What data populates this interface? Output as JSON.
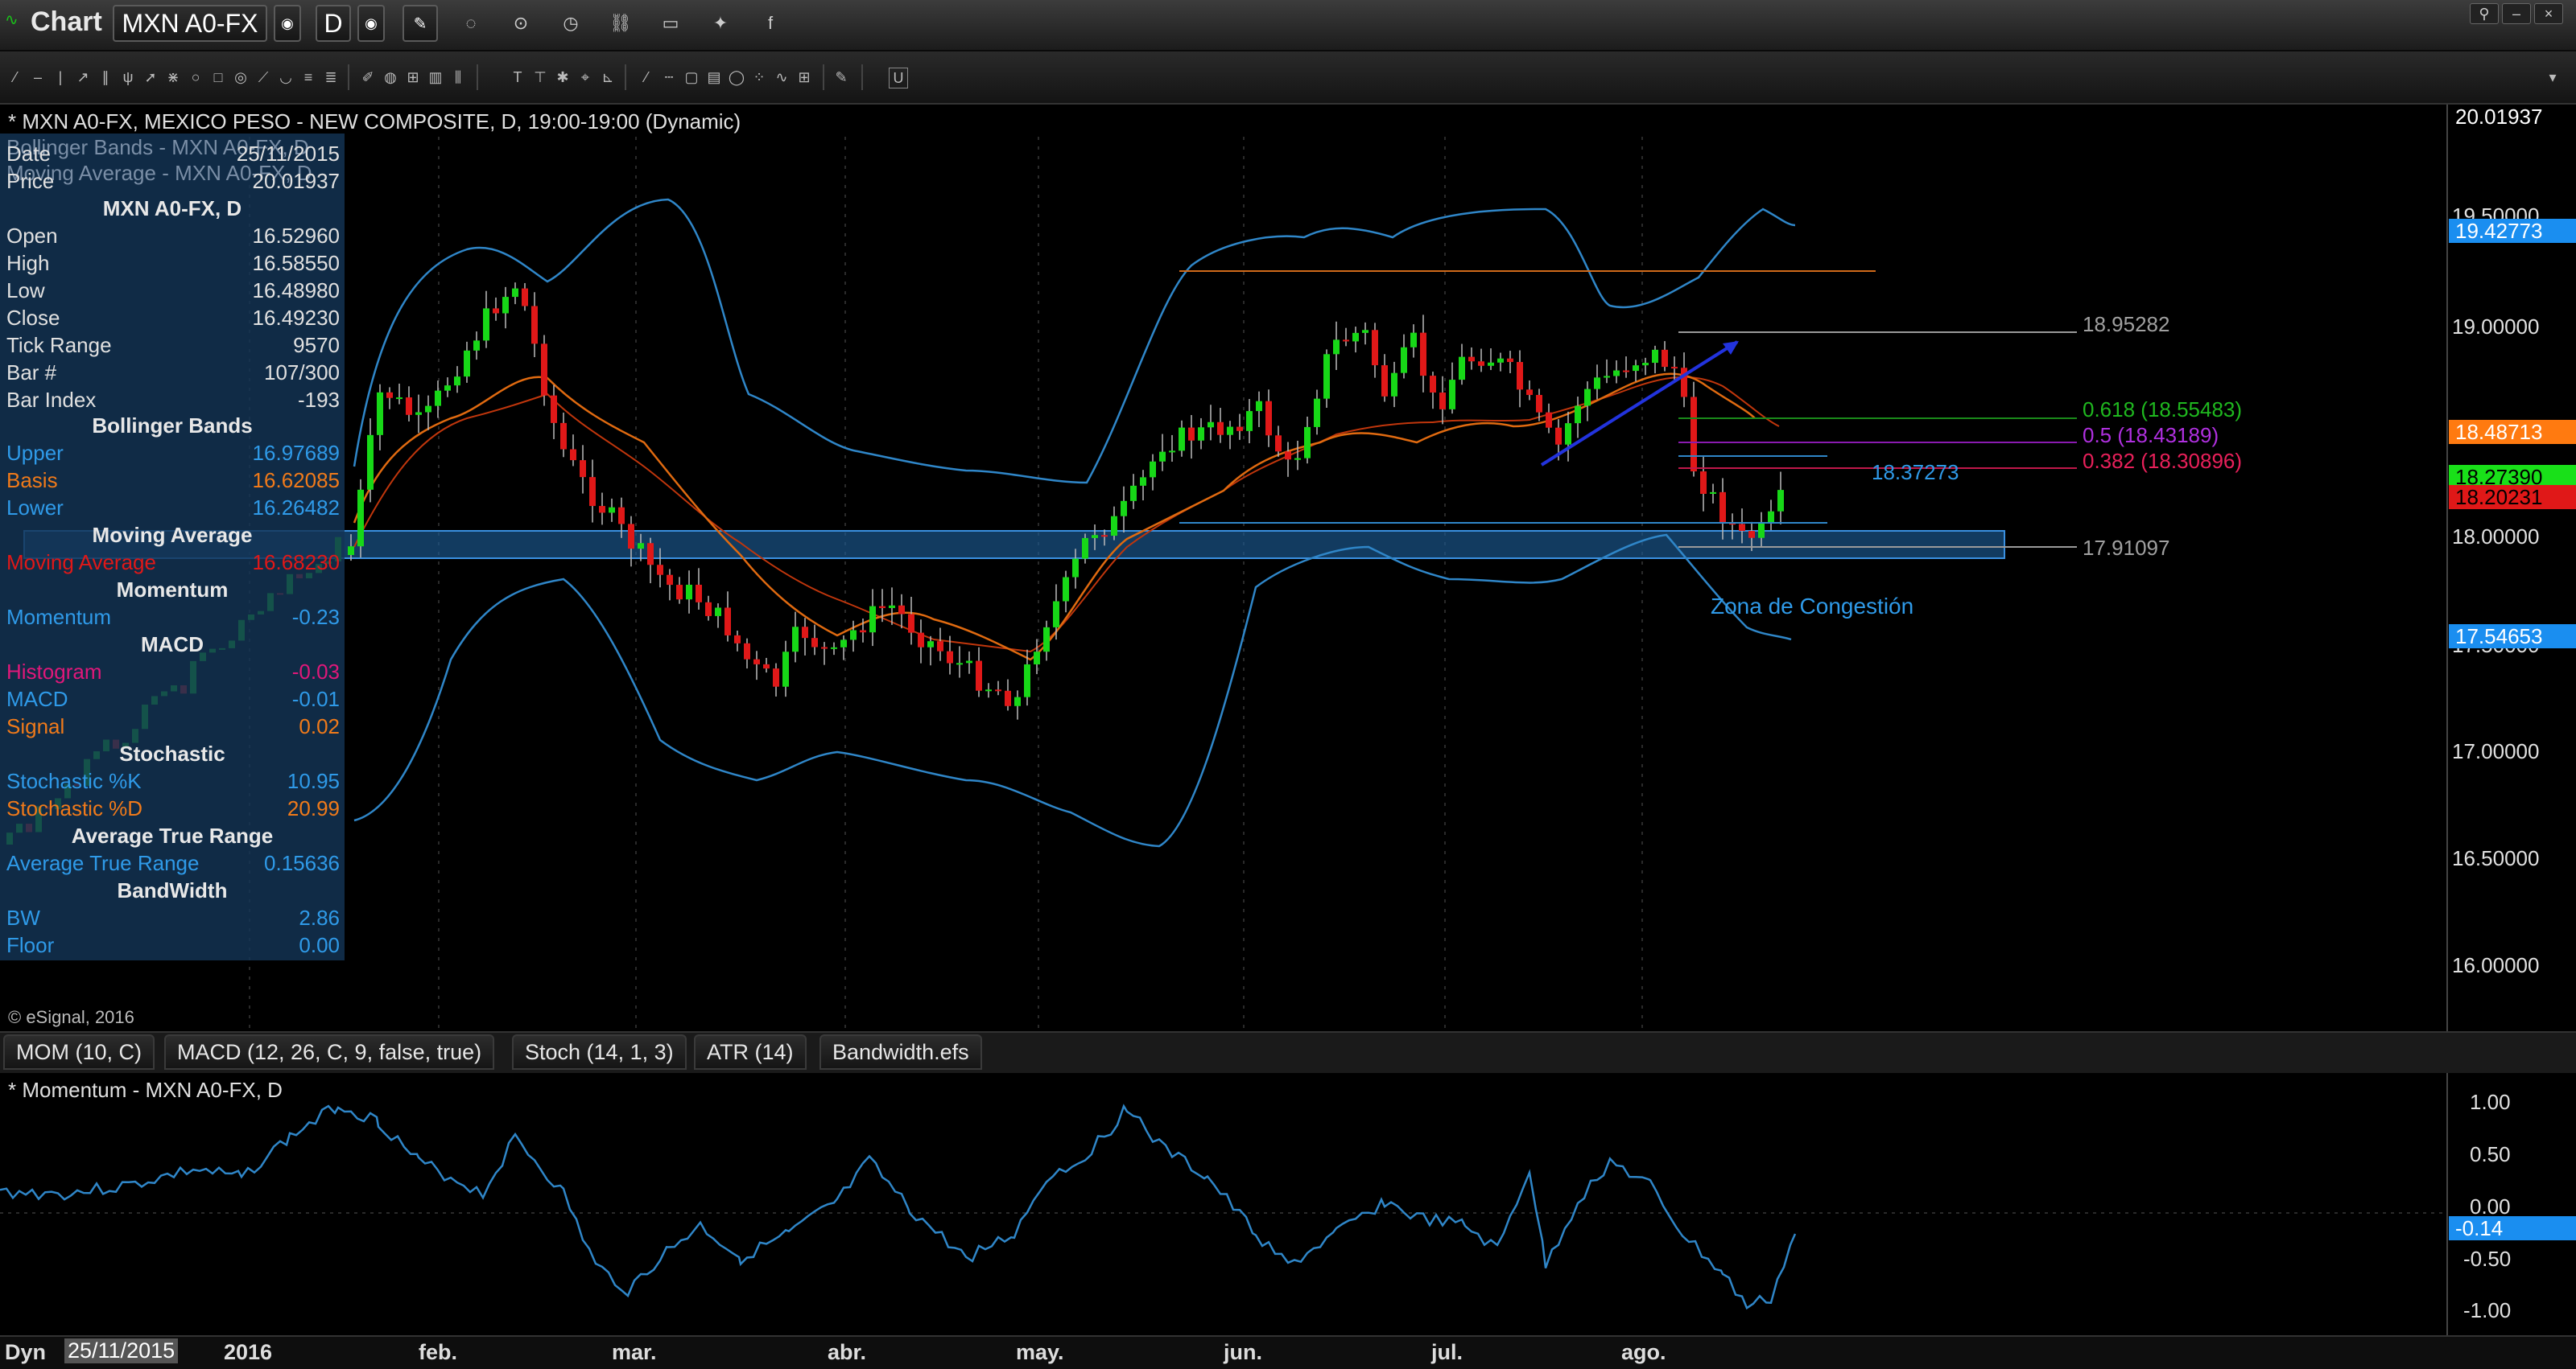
{
  "app": {
    "title": "Chart"
  },
  "toolbar": {
    "symbol": "MXN A0-FX",
    "interval": "D"
  },
  "chart": {
    "title": "* MXN A0-FX, MEXICO PESO - NEW COMPOSITE, D, 19:00-19:00 (Dynamic)",
    "ghost_lines": [
      "Bollinger Bands - MXN A0-FX, D",
      "Moving Average - MXN A0-FX, D"
    ],
    "copyright": "© eSignal, 2016",
    "annotation_text": "Zona de Congestión",
    "fib_high_label": "18.95282",
    "fib_low_label": "17.91097",
    "fib_618": "0.618 (18.55483)",
    "fib_50": "0.5 (18.43189)",
    "fib_382": "0.382 (18.30896)",
    "line_value_label": "18.37273",
    "price_labels": [
      "20.01937",
      "19.42773",
      "18.48713",
      "18.27390",
      "18.20231",
      "17.54653"
    ],
    "price_ticks": [
      "19.50000",
      "19.00000",
      "18.00000",
      "17.50000",
      "17.00000",
      "16.50000",
      "16.00000"
    ],
    "colors": {
      "background": "#000000",
      "up_candle": "#17d817",
      "down_candle": "#e01818",
      "bollinger": "#2f86c8",
      "moving_average": "#e06a10",
      "congestion_zone": "#2a78c0"
    }
  },
  "data_window": {
    "date_label": "Date",
    "date_value": "25/11/2015",
    "price_label": "Price",
    "price_value": "20.01937",
    "symbol_header": "MXN A0-FX, D",
    "rows": [
      {
        "label": "Open",
        "value": "16.52960"
      },
      {
        "label": "High",
        "value": "16.58550"
      },
      {
        "label": "Low",
        "value": "16.48980"
      },
      {
        "label": "Close",
        "value": "16.49230"
      },
      {
        "label": "Tick Range",
        "value": "9570"
      },
      {
        "label": "Bar #",
        "value": "107/300"
      },
      {
        "label": "Bar Index",
        "value": "-193"
      }
    ],
    "bollinger_header": "Bollinger Bands",
    "bb_upper": {
      "label": "Upper",
      "value": "16.97689"
    },
    "bb_basis": {
      "label": "Basis",
      "value": "16.62085"
    },
    "bb_lower": {
      "label": "Lower",
      "value": "16.26482"
    },
    "ma_header": "Moving Average",
    "ma": {
      "label": "Moving Average",
      "value": "16.68230"
    },
    "momentum_header": "Momentum",
    "momentum": {
      "label": "Momentum",
      "value": "-0.23"
    },
    "macd_header": "MACD",
    "histogram": {
      "label": "Histogram",
      "value": "-0.03"
    },
    "macd": {
      "label": "MACD",
      "value": "-0.01"
    },
    "signal": {
      "label": "Signal",
      "value": "0.02"
    },
    "stochastic_header": "Stochastic",
    "stoch_k": {
      "label": "Stochastic %K",
      "value": "10.95"
    },
    "stoch_d": {
      "label": "Stochastic %D",
      "value": "20.99"
    },
    "atr_header": "Average True Range",
    "atr": {
      "label": "Average True Range",
      "value": "0.15636"
    },
    "bandwidth_header": "BandWidth",
    "bw": {
      "label": "BW",
      "value": "2.86"
    },
    "floor": {
      "label": "Floor",
      "value": "0.00"
    }
  },
  "tabs": [
    "MOM (10, C)",
    "MACD (12, 26, C, 9, false, true)",
    "Stoch (14, 1, 3)",
    "ATR (14)",
    "Bandwidth.efs"
  ],
  "momentum_pane": {
    "title": "* Momentum - MXN A0-FX, D",
    "ticks": [
      "1.00",
      "0.50",
      "0.00",
      "-0.50",
      "-1.00"
    ],
    "value_label": "-0.14"
  },
  "bottom_bar": {
    "mode": "Dyn",
    "date": "25/11/2015"
  },
  "x_axis": [
    "2016",
    "feb.",
    "mar.",
    "abr.",
    "may.",
    "jun.",
    "jul.",
    "ago."
  ]
}
